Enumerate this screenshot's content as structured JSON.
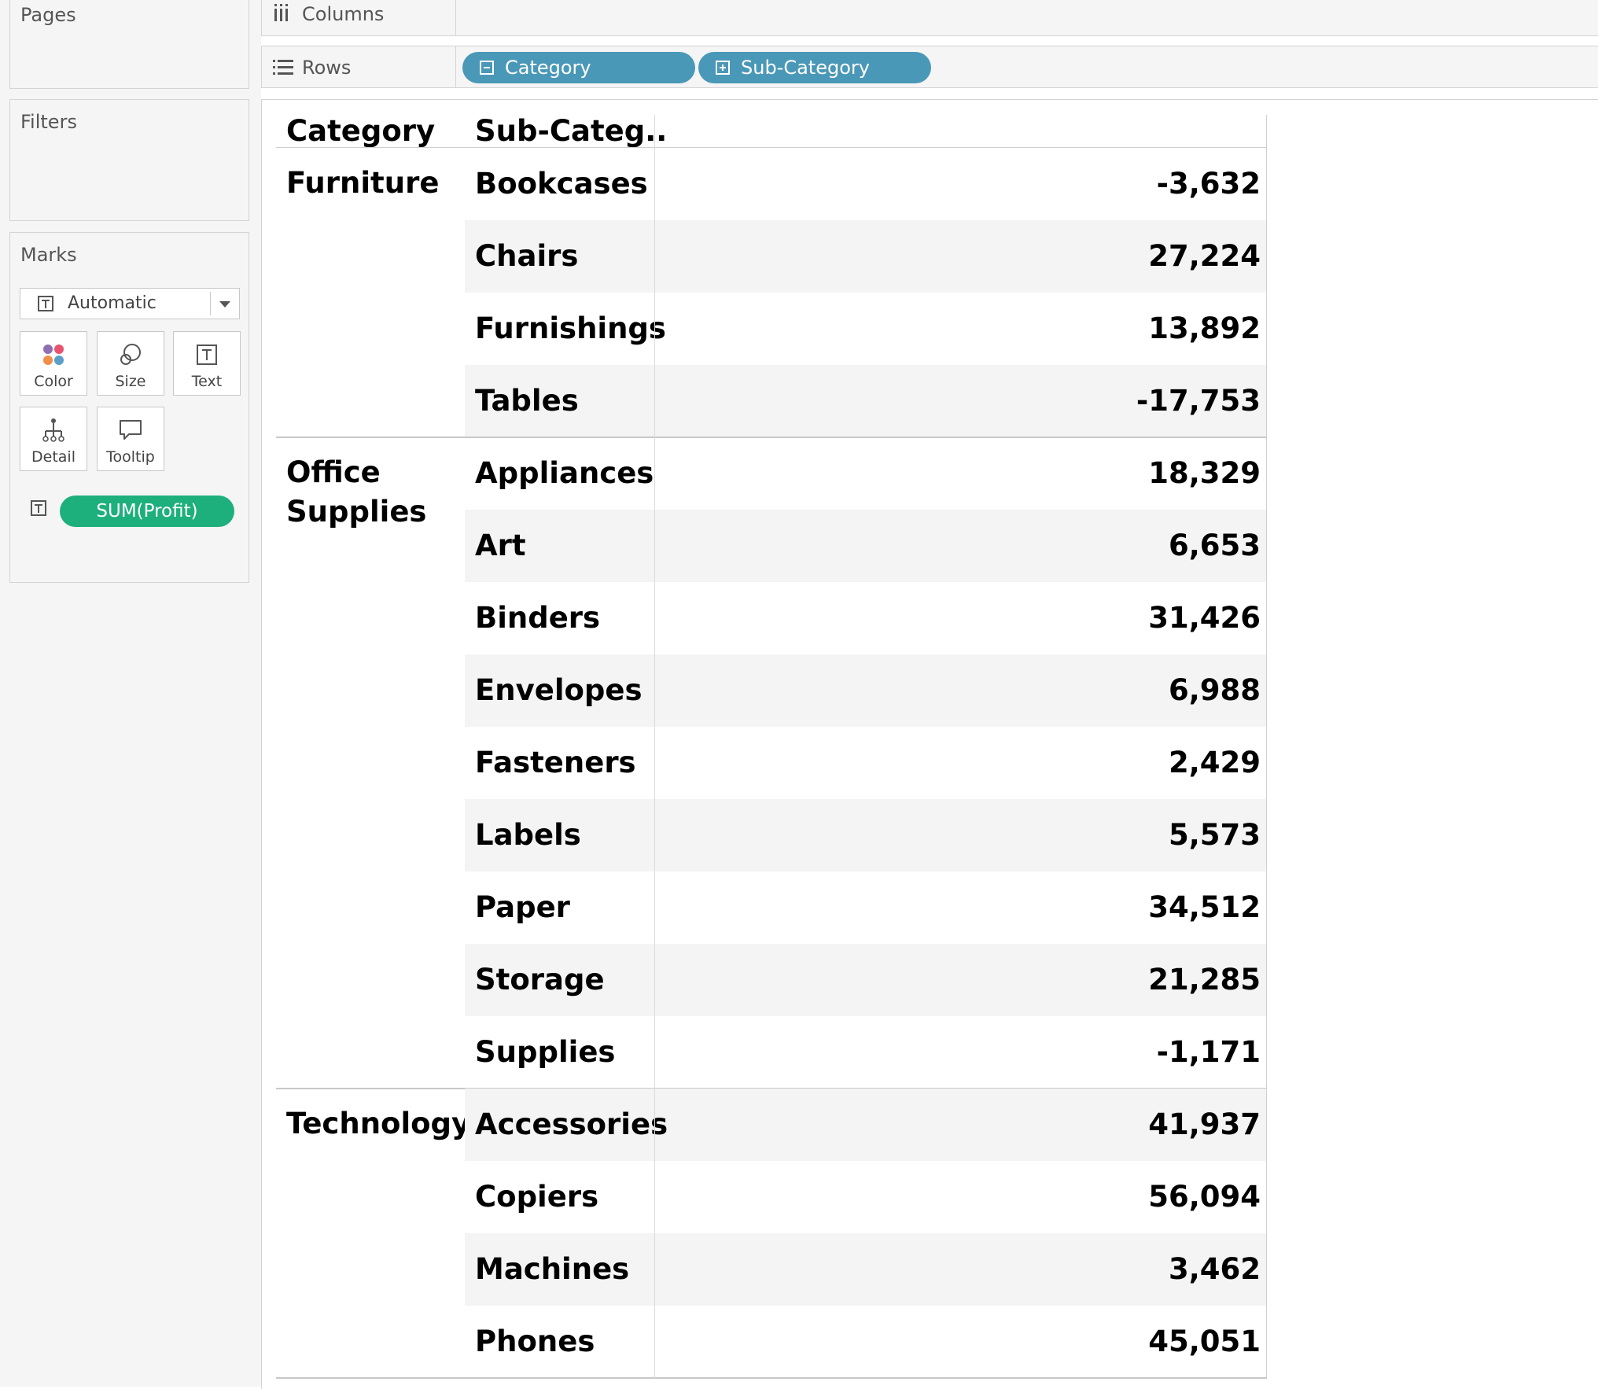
{
  "panels": {
    "pages": "Pages",
    "filters": "Filters",
    "marks": "Marks"
  },
  "marks": {
    "type": "Automatic",
    "buttons": {
      "color": "Color",
      "size": "Size",
      "text": "Text",
      "detail": "Detail",
      "tooltip": "Tooltip"
    },
    "field_pill": "SUM(Profit)"
  },
  "shelves": {
    "columns_label": "Columns",
    "rows_label": "Rows",
    "rows_pills": [
      "Category",
      "Sub-Category"
    ]
  },
  "table": {
    "headers": {
      "category": "Category",
      "subcategory": "Sub-Categ.."
    },
    "groups": [
      {
        "category": "Furniture",
        "rows": [
          {
            "sub": "Bookcases",
            "value": "-3,632"
          },
          {
            "sub": "Chairs",
            "value": "27,224"
          },
          {
            "sub": "Furnishings",
            "value": "13,892"
          },
          {
            "sub": "Tables",
            "value": "-17,753"
          }
        ]
      },
      {
        "category": "Office Supplies",
        "rows": [
          {
            "sub": "Appliances",
            "value": "18,329"
          },
          {
            "sub": "Art",
            "value": "6,653"
          },
          {
            "sub": "Binders",
            "value": "31,426"
          },
          {
            "sub": "Envelopes",
            "value": "6,988"
          },
          {
            "sub": "Fasteners",
            "value": "2,429"
          },
          {
            "sub": "Labels",
            "value": "5,573"
          },
          {
            "sub": "Paper",
            "value": "34,512"
          },
          {
            "sub": "Storage",
            "value": "21,285"
          },
          {
            "sub": "Supplies",
            "value": "-1,171"
          }
        ]
      },
      {
        "category": "Technology",
        "rows": [
          {
            "sub": "Accessories",
            "value": "41,937"
          },
          {
            "sub": "Copiers",
            "value": "56,094"
          },
          {
            "sub": "Machines",
            "value": "3,462"
          },
          {
            "sub": "Phones",
            "value": "45,051"
          }
        ]
      }
    ]
  },
  "colors": {
    "dimension_pill": "#4a98b7",
    "measure_pill": "#1daf7c",
    "row_band": "#f4f4f4"
  }
}
